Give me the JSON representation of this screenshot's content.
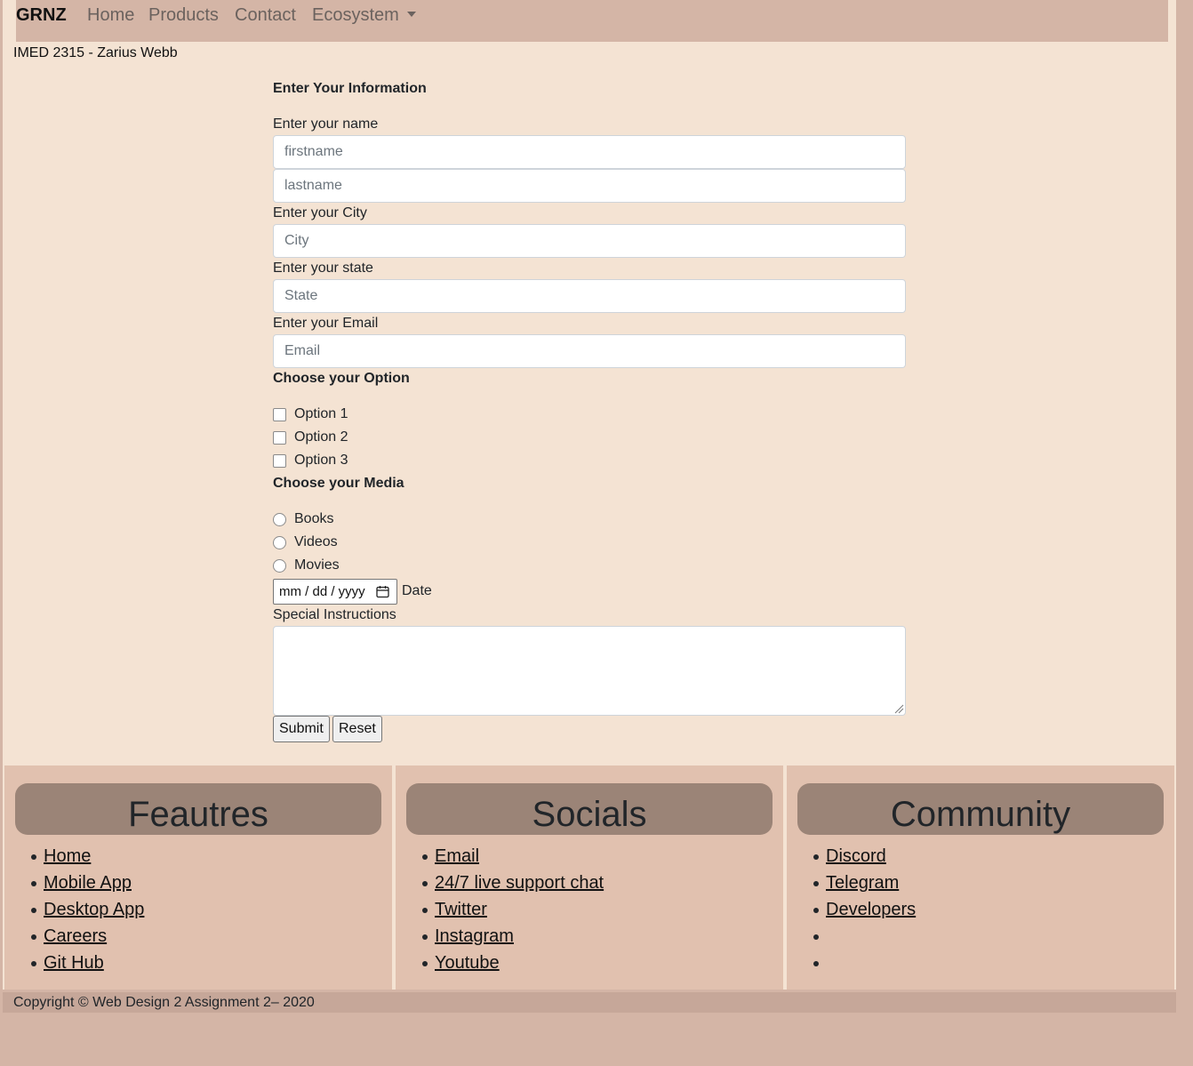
{
  "navbar": {
    "brand": "GRNZ",
    "links": [
      "Home",
      "Products",
      "Contact",
      "Ecosystem"
    ]
  },
  "subtitle": "IMED 2315 - Zarius Webb",
  "form": {
    "heading": "Enter Your Information",
    "name_label": "Enter your name",
    "firstname_placeholder": "firstname",
    "lastname_placeholder": "lastname",
    "city_label": "Enter your City",
    "city_placeholder": "City",
    "state_label": "Enter your state",
    "state_placeholder": "State",
    "email_label": "Enter your Email",
    "email_placeholder": "Email",
    "options_heading": "Choose your Option",
    "options": [
      "Option 1",
      "Option 2",
      "Option 3"
    ],
    "media_heading": "Choose your Media",
    "media": [
      "Books",
      "Videos",
      "Movies"
    ],
    "date_value": "mm / dd / yyyy",
    "date_label": "Date",
    "instructions_label": "Special Instructions",
    "submit_label": "Submit",
    "reset_label": "Reset"
  },
  "footer": {
    "columns": [
      {
        "title": "Feautres",
        "items": [
          "Home",
          "Mobile App",
          "Desktop App",
          "Careers",
          "Git Hub"
        ]
      },
      {
        "title": "Socials",
        "items": [
          "Email",
          "24/7 live support chat",
          "Twitter",
          "Instagram",
          "Youtube"
        ]
      },
      {
        "title": "Community",
        "items": [
          "Discord",
          "Telegram",
          "Developers",
          "",
          ""
        ]
      }
    ],
    "copyright": "Copyright © Web Design 2 Assignment 2– 2020"
  },
  "colors": {
    "page_bg": "#f4e3d3",
    "navbar_bg": "#d4b5a6",
    "footer_col_bg": "#e1c1af",
    "footer_head_bg": "#9b8477"
  }
}
